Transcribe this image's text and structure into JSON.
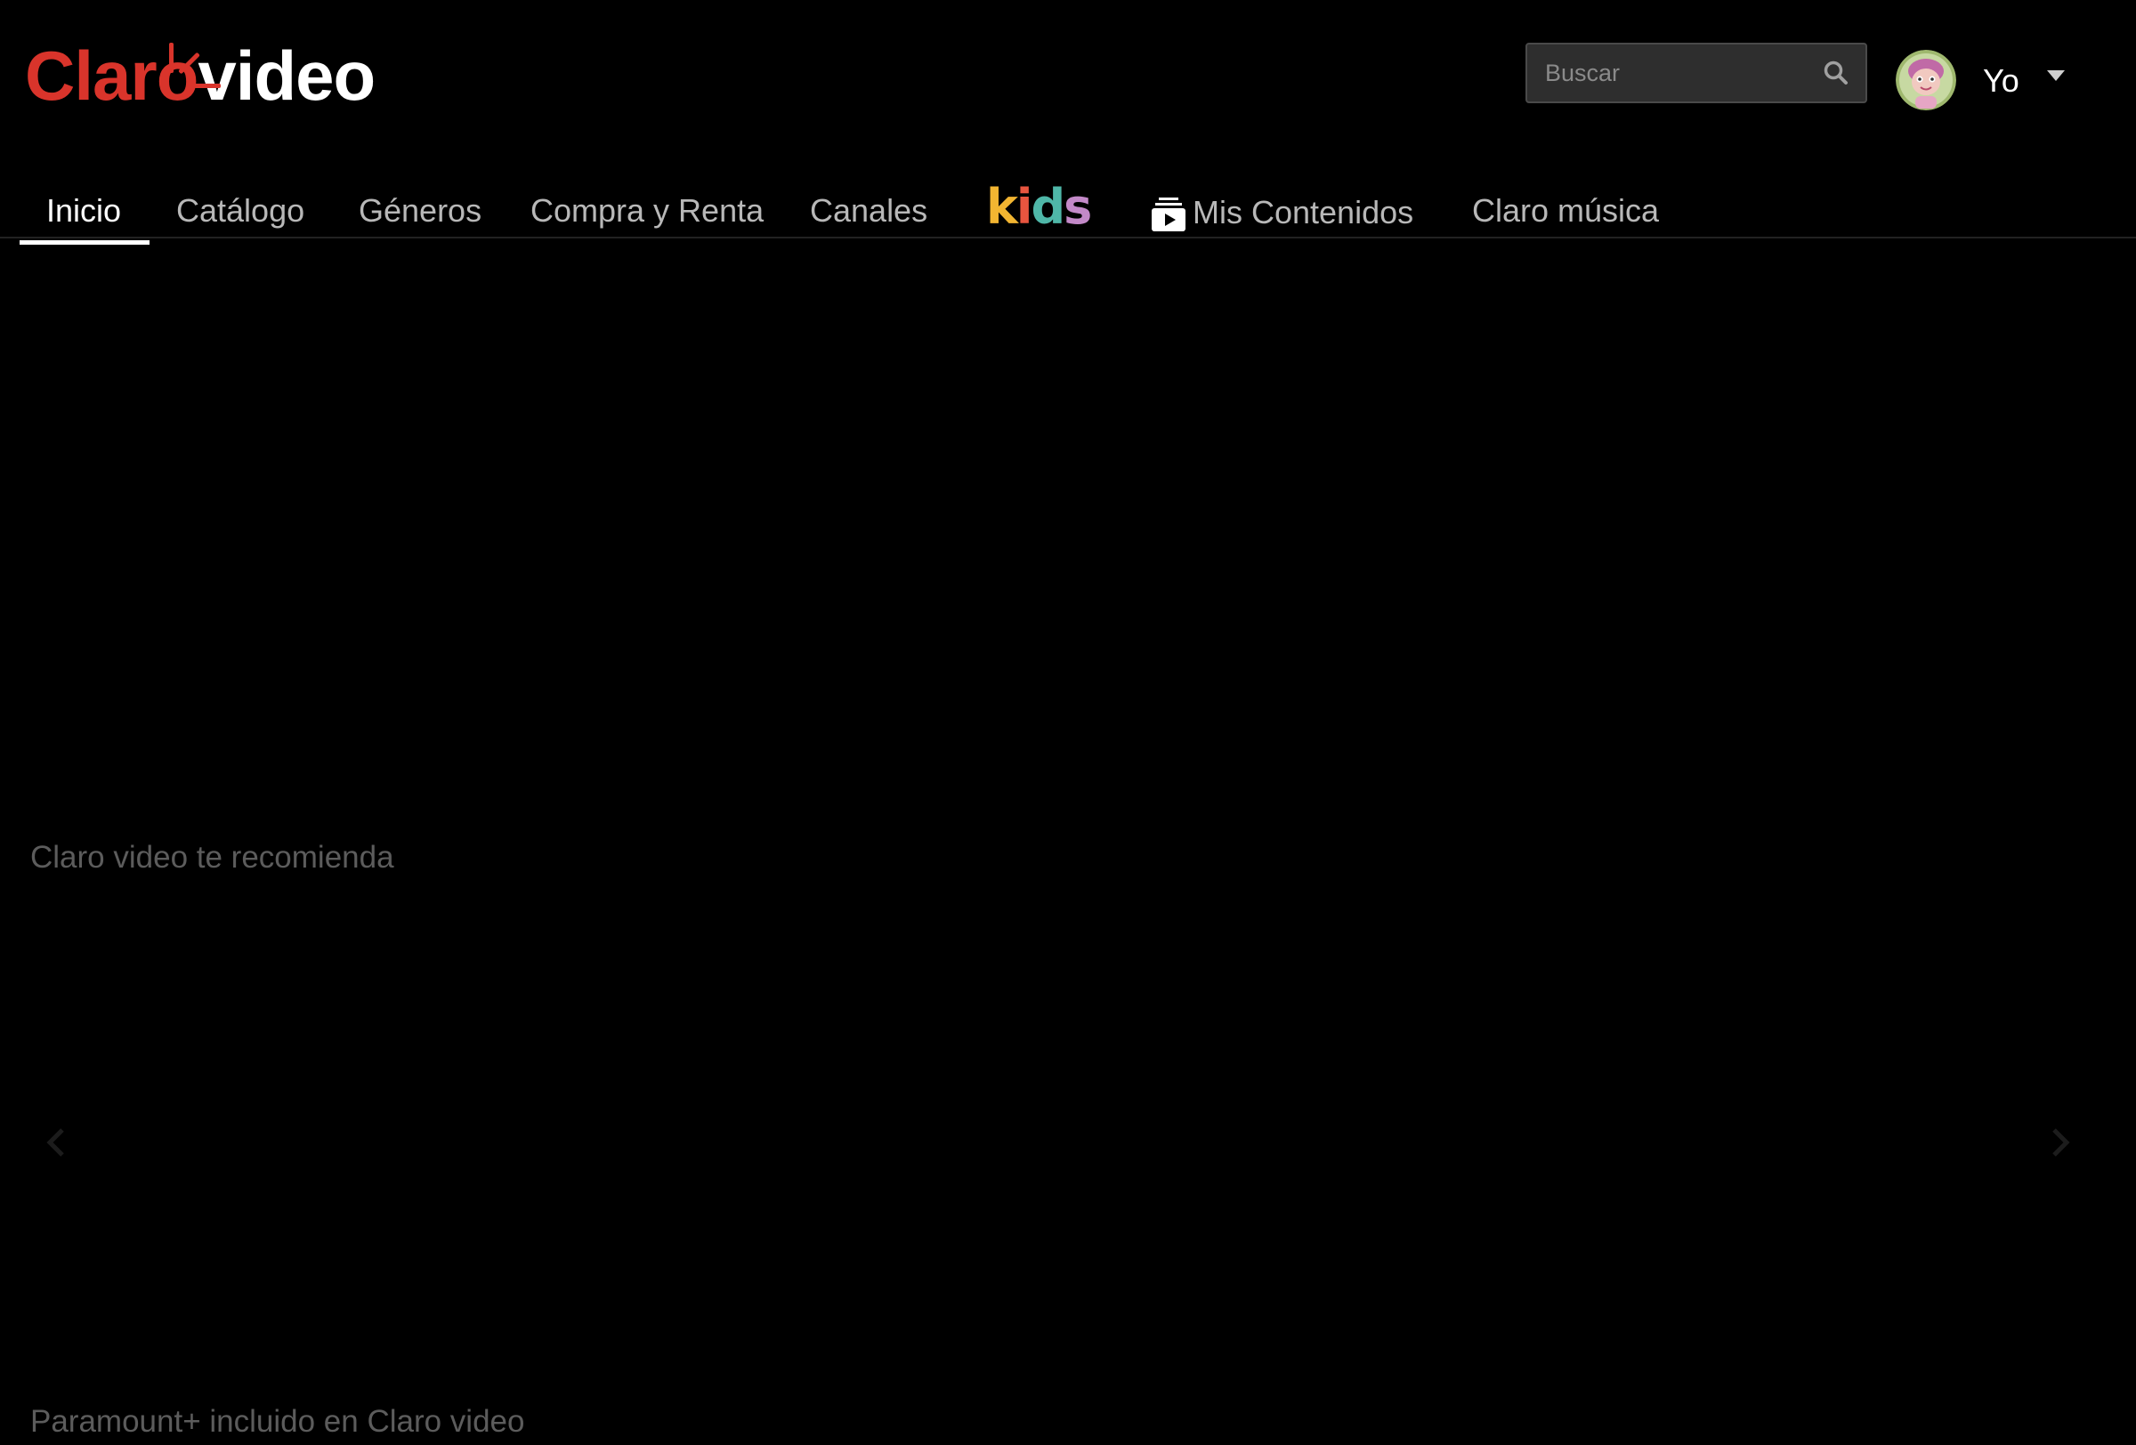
{
  "header": {
    "logo": {
      "brand": "Claro",
      "product": "video"
    },
    "search": {
      "placeholder": "Buscar",
      "value": "",
      "icon": "search-icon"
    },
    "user": {
      "name": "Yo",
      "avatar_icon": "avatar"
    }
  },
  "nav": {
    "items": [
      {
        "label": "Inicio",
        "active": true
      },
      {
        "label": "Catálogo",
        "active": false
      },
      {
        "label": "Géneros",
        "active": false
      },
      {
        "label": "Compra y Renta",
        "active": false
      },
      {
        "label": "Canales",
        "active": false
      },
      {
        "label": "kids",
        "active": false
      },
      {
        "label": "Mis Contenidos",
        "active": false,
        "icon": "play-stack-icon"
      },
      {
        "label": "Claro música",
        "active": false
      }
    ]
  },
  "sections": [
    {
      "title": "Claro video te recomienda"
    },
    {
      "title": "Paramount+ incluido en Claro video"
    }
  ],
  "colors": {
    "brand_red": "#d9342b",
    "background": "#000000",
    "nav_text": "#b8b8b8",
    "active_text": "#ffffff",
    "section_title": "#5c5c5c",
    "kids_k": "#f2b531",
    "kids_i": "#e8553f",
    "kids_d": "#4fb7a8",
    "kids_s": "#c389c8"
  }
}
